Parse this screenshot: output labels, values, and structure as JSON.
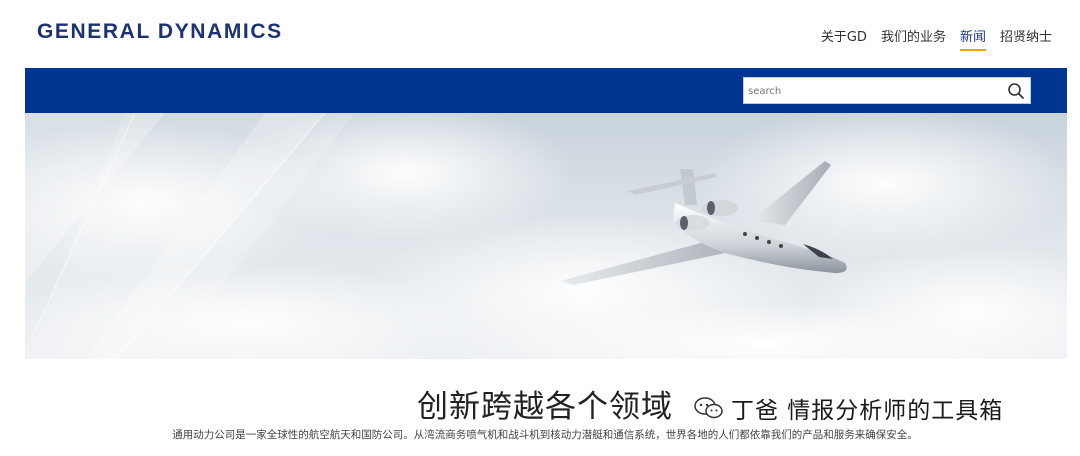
{
  "header": {
    "logo": "GENERAL DYNAMICS",
    "nav": [
      {
        "label": "关于GD"
      },
      {
        "label": "我们的业务"
      },
      {
        "label": "新闻",
        "active": true
      },
      {
        "label": "招贤纳士"
      }
    ]
  },
  "search": {
    "placeholder": "search",
    "icon": "search-icon"
  },
  "hero": {
    "image": "business-jet-over-clouds"
  },
  "content": {
    "headline": "创新跨越各个领域",
    "intro": "通用动力公司是一家全球性的航空航天和国防公司。从湾流商务喷气机和战斗机到核动力潜艇和通信系统，世界各地的人们都依靠我们的产品和服务来确保安全。"
  },
  "watermark": {
    "text": "丁爸 情报分析师的工具箱",
    "icon": "wechat-icon"
  },
  "colors": {
    "brand_blue": "#003591",
    "logo_blue": "#1c3272",
    "active_underline": "#f0a200"
  }
}
